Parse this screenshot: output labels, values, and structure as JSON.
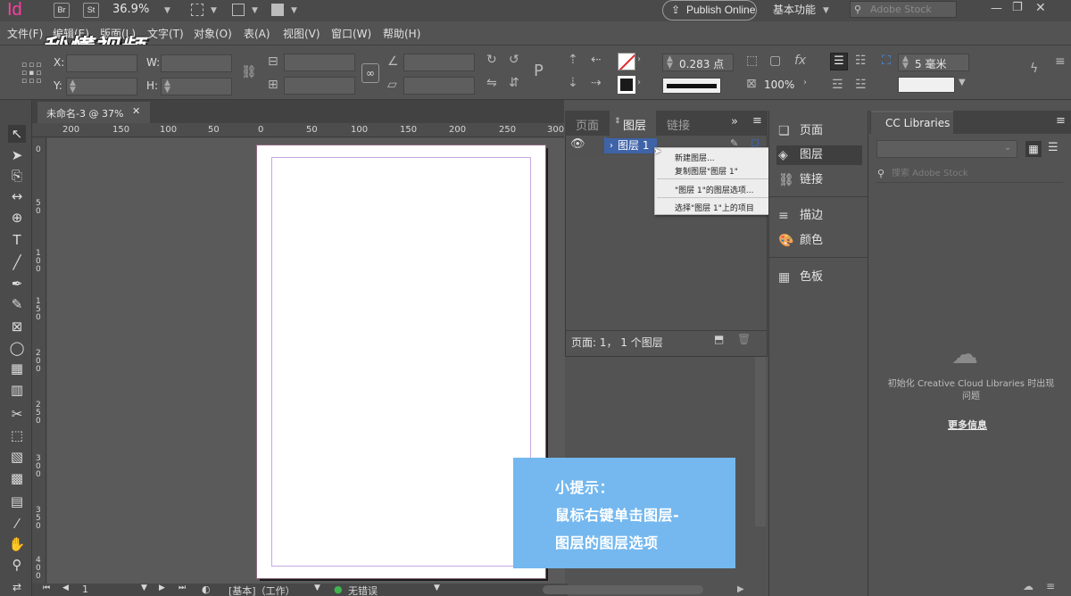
{
  "app": {
    "logo": "Id",
    "bridge_label": "Br",
    "stock_label": "St",
    "zoom": "36.9%",
    "publish_label": "Publish Online",
    "workspace": "基本功能",
    "stock_search_placeholder": "Adobe Stock"
  },
  "menu": [
    "文件(F)",
    "编辑(E)",
    "版面(L)",
    "文字(T)",
    "对象(O)",
    "表(A)",
    "视图(V)",
    "窗口(W)",
    "帮助(H)"
  ],
  "watermark": "秒懂视频",
  "control": {
    "x_label": "X:",
    "y_label": "Y:",
    "w_label": "W:",
    "h_label": "H:",
    "stroke_weight": "0.283 点",
    "scale": "100%",
    "gap": "5 毫米"
  },
  "document": {
    "tab_title": "未命名-3 @ 37%",
    "h_ruler": [
      "200",
      "150",
      "100",
      "50",
      "0",
      "50",
      "100",
      "150",
      "200",
      "250",
      "300"
    ],
    "v_ruler": [
      "0",
      "50",
      "100",
      "150",
      "200",
      "250",
      "300",
      "350",
      "400"
    ]
  },
  "layers_panel": {
    "tabs": [
      "页面",
      "图层",
      "链接"
    ],
    "active_tab": "图层",
    "layer_name": "图层 1",
    "footer": "页面: 1， 1 个图层"
  },
  "context_menu": {
    "items": [
      "新建图层...",
      "复制图层\"图层 1\"",
      "\"图层 1\"的图层选项...",
      "选择\"图层 1\"上的项目"
    ]
  },
  "dock_panels": [
    "页面",
    "图层",
    "链接",
    "描边",
    "颜色",
    "色板"
  ],
  "cc_libraries": {
    "tab": "CC Libraries",
    "search_placeholder": "搜索 Adobe Stock",
    "message": "初始化 Creative Cloud Libraries 时出现问题",
    "more_info": "更多信息"
  },
  "tip": {
    "title": "小提示：",
    "line1": "鼠标右键单击图层-",
    "line2": "图层的图层选项"
  },
  "status_bar": {
    "page_number": "1",
    "master": "[基本]（工作）",
    "errors": "无错误"
  },
  "colors": {
    "accent_logo": "#ff3da2",
    "selection_blue": "#3f63a7",
    "tip_background": "#74b8ef",
    "ok_green": "#3fb34f"
  }
}
